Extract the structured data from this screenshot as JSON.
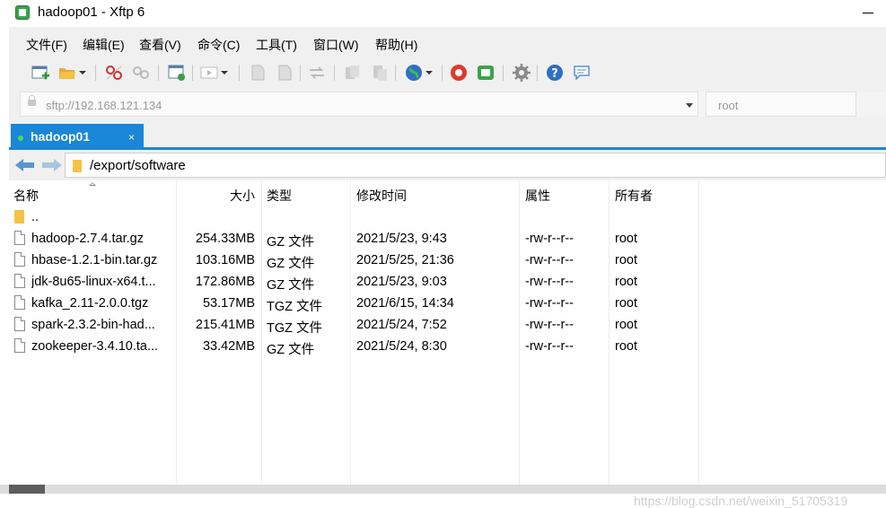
{
  "window": {
    "title": "hadoop01    - Xftp 6"
  },
  "menu": [
    {
      "label": "文件(F)"
    },
    {
      "label": "编辑(E)"
    },
    {
      "label": "查看(V)"
    },
    {
      "label": "命令(C)"
    },
    {
      "label": "工具(T)"
    },
    {
      "label": "窗口(W)"
    },
    {
      "label": "帮助(H)"
    }
  ],
  "toolbar": {
    "icons": [
      "new-session-icon",
      "open-folder-icon",
      "disconnect-icon",
      "link-icon",
      "properties-icon",
      "transfer-icon",
      "upload-icon",
      "download-icon",
      "sync-icon",
      "copy-icon",
      "paste-icon",
      "globe-icon",
      "xshell-icon",
      "xftp-icon",
      "gear-icon",
      "help-icon",
      "chat-icon"
    ]
  },
  "address": {
    "url": "sftp://192.168.121.134",
    "user": "root"
  },
  "tab": {
    "label": "hadoop01",
    "close": "×",
    "status_color": "#4cd964"
  },
  "path": {
    "value": "/export/software"
  },
  "columns": {
    "name": "名称",
    "size": "大小",
    "type": "类型",
    "modified": "修改时间",
    "attributes": "属性",
    "owner": "所有者"
  },
  "rows": [
    {
      "name": "..",
      "size": "",
      "type": "",
      "modified": "",
      "attributes": "",
      "owner": "",
      "icon": "folder-icon"
    },
    {
      "name": "hadoop-2.7.4.tar.gz",
      "size": "254.33MB",
      "type": "GZ 文件",
      "modified": "2021/5/23, 9:43",
      "attributes": "-rw-r--r--",
      "owner": "root",
      "icon": "file-icon"
    },
    {
      "name": "hbase-1.2.1-bin.tar.gz",
      "size": "103.16MB",
      "type": "GZ 文件",
      "modified": "2021/5/25, 21:36",
      "attributes": "-rw-r--r--",
      "owner": "root",
      "icon": "file-icon"
    },
    {
      "name": "jdk-8u65-linux-x64.t...",
      "size": "172.86MB",
      "type": "GZ 文件",
      "modified": "2021/5/23, 9:03",
      "attributes": "-rw-r--r--",
      "owner": "root",
      "icon": "file-icon"
    },
    {
      "name": "kafka_2.11-2.0.0.tgz",
      "size": "53.17MB",
      "type": "TGZ 文件",
      "modified": "2021/6/15, 14:34",
      "attributes": "-rw-r--r--",
      "owner": "root",
      "icon": "file-icon"
    },
    {
      "name": "spark-2.3.2-bin-had...",
      "size": "215.41MB",
      "type": "TGZ 文件",
      "modified": "2021/5/24, 7:52",
      "attributes": "-rw-r--r--",
      "owner": "root",
      "icon": "file-icon"
    },
    {
      "name": "zookeeper-3.4.10.ta...",
      "size": "33.42MB",
      "type": "GZ 文件",
      "modified": "2021/5/24, 8:30",
      "attributes": "-rw-r--r--",
      "owner": "root",
      "icon": "file-icon"
    }
  ],
  "watermark": "https://blog.csdn.net/weixin_51705319",
  "colors": {
    "accent": "#1a86d6",
    "folder": "#f6c244"
  }
}
